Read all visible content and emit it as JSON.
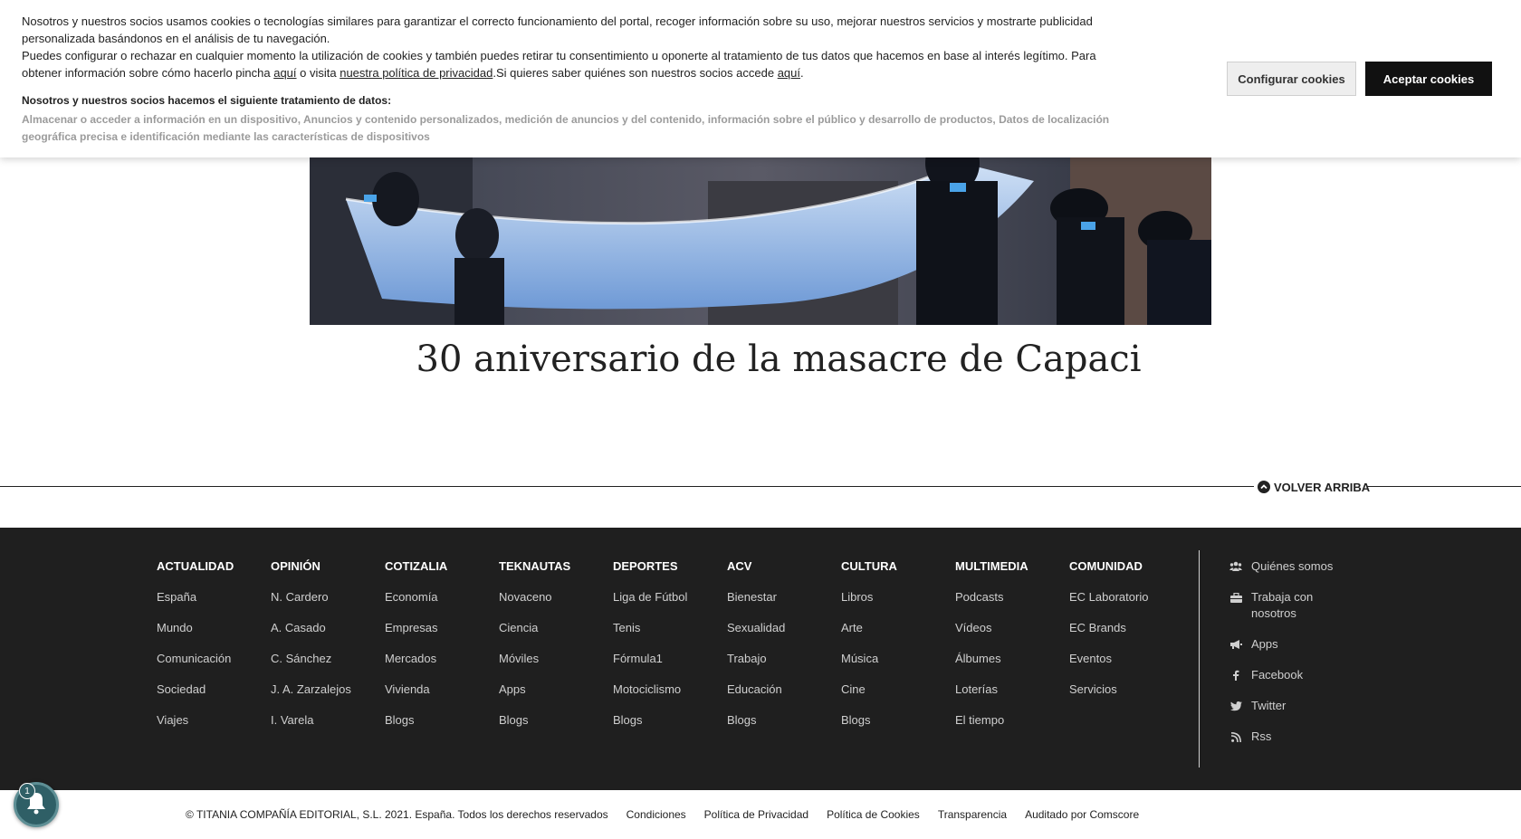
{
  "cookies": {
    "para1": "Nosotros y nuestros socios usamos cookies o tecnologías similares para garantizar el correcto funcionamiento del portal, recoger información sobre su uso, mejorar nuestros servicios y mostrarte publicidad personalizada basándonos en el análisis de tu navegación.",
    "para2_a": "Puedes configurar o rechazar en cualquier momento la utilización de cookies y también puedes retirar tu consentimiento u oponerte al tratamiento de tus datos que hacemos en base al interés legítimo. Para obtener información sobre cómo hacerlo pincha ",
    "link_aqui1": "aquí",
    "para2_b": " o visita ",
    "link_privacy": "nuestra política de privacidad",
    "para2_c": ".Si quieres saber quiénes son nuestros socios accede ",
    "link_aqui2": "aquí",
    "para2_d": ".",
    "partners_title": "Nosotros y nuestros socios hacemos el siguiente tratamiento de datos:",
    "partners_list": "Almacenar o acceder a información en un dispositivo, Anuncios y contenido personalizados, medición de anuncios y del contenido, información sobre el público y desarrollo de productos, Datos de localización geográfica precisa e identificación mediante las características de dispositivos",
    "configure_label": "Configurar cookies",
    "accept_label": "Aceptar cookies"
  },
  "article": {
    "title": "30 aniversario de la masacre de Capaci"
  },
  "back_to_top": "VOLVER ARRIBA",
  "footer": {
    "columns": [
      {
        "title": "ACTUALIDAD",
        "links": [
          "España",
          "Mundo",
          "Comunicación",
          "Sociedad",
          "Viajes"
        ]
      },
      {
        "title": "OPINIÓN",
        "links": [
          "N. Cardero",
          "A. Casado",
          "C. Sánchez",
          "J. A. Zarzalejos",
          "I. Varela"
        ]
      },
      {
        "title": "COTIZALIA",
        "links": [
          "Economía",
          "Empresas",
          "Mercados",
          "Vivienda",
          "Blogs"
        ]
      },
      {
        "title": "TEKNAUTAS",
        "links": [
          "Novaceno",
          "Ciencia",
          "Móviles",
          "Apps",
          "Blogs"
        ]
      },
      {
        "title": "DEPORTES",
        "links": [
          "Liga de Fútbol",
          "Tenis",
          "Fórmula1",
          "Motociclismo",
          "Blogs"
        ]
      },
      {
        "title": "ACV",
        "links": [
          "Bienestar",
          "Sexualidad",
          "Trabajo",
          "Educación",
          "Blogs"
        ]
      },
      {
        "title": "CULTURA",
        "links": [
          "Libros",
          "Arte",
          "Música",
          "Cine",
          "Blogs"
        ]
      },
      {
        "title": "MULTIMEDIA",
        "links": [
          "Podcasts",
          "Vídeos",
          "Álbumes",
          "Loterías",
          "El tiempo"
        ]
      },
      {
        "title": "COMUNIDAD",
        "links": [
          "EC Laboratorio",
          "EC Brands",
          "Eventos",
          "Servicios"
        ]
      }
    ],
    "side_links": [
      {
        "label": "Quiénes somos",
        "icon": "users-icon"
      },
      {
        "label": "Trabaja con nosotros",
        "icon": "briefcase-icon"
      },
      {
        "label": "Apps",
        "icon": "megaphone-icon"
      },
      {
        "label": "Facebook",
        "icon": "facebook-icon"
      },
      {
        "label": "Twitter",
        "icon": "twitter-icon"
      },
      {
        "label": "Rss",
        "icon": "rss-icon"
      }
    ]
  },
  "bottom": {
    "copyright": "© TITANIA COMPAÑÍA EDITORIAL, S.L. 2021. España. Todos los derechos reservados",
    "links": [
      "Condiciones",
      "Política de Privacidad",
      "Política de Cookies",
      "Transparencia",
      "Auditado por Comscore"
    ]
  },
  "notification": {
    "count": "1"
  }
}
